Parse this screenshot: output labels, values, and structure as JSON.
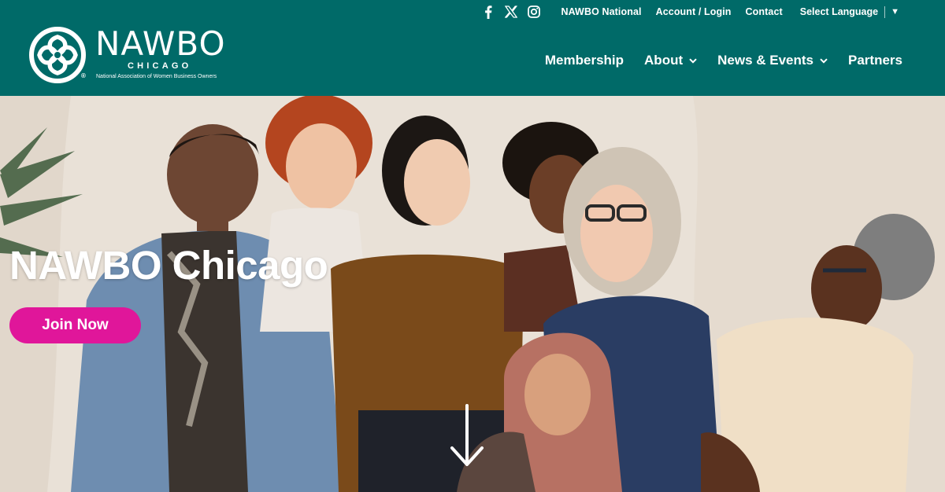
{
  "header": {
    "background_color": "#006a68",
    "social_icons": [
      {
        "name": "facebook-icon",
        "glyph": "f"
      },
      {
        "name": "x-icon",
        "glyph": "X"
      },
      {
        "name": "instagram-icon",
        "glyph": "instagram"
      }
    ],
    "top_links": [
      "NAWBO National",
      "Account / Login",
      "Contact"
    ],
    "language_selector": {
      "label": "Select Language",
      "arrow": "▼"
    },
    "logo": {
      "wordmark": "NAWBO",
      "city": "CHICAGO",
      "tagline": "National Association of Women Business Owners",
      "registered": "®"
    },
    "nav": [
      {
        "label": "Membership",
        "has_dropdown": false
      },
      {
        "label": "About",
        "has_dropdown": true
      },
      {
        "label": "News & Events",
        "has_dropdown": true
      },
      {
        "label": "Partners",
        "has_dropdown": false
      }
    ]
  },
  "hero": {
    "title": "NAWBO Chicago",
    "cta_label": "Join Now",
    "cta_color": "#e0169a",
    "scroll_icon": "arrow-down-icon"
  }
}
